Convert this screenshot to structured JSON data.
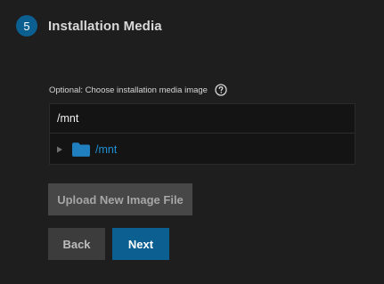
{
  "step": {
    "number": "5",
    "title": "Installation Media"
  },
  "field": {
    "label": "Optional: Choose installation media image",
    "help_icon": "help-circle-icon"
  },
  "explorer": {
    "path_value": "/mnt",
    "tree": [
      {
        "label": "/mnt",
        "expanded": false,
        "icon": "folder-icon"
      }
    ]
  },
  "buttons": {
    "upload": "Upload New Image File",
    "back": "Back",
    "next": "Next"
  },
  "colors": {
    "background": "#1e1e1e",
    "accent": "#0b5f91",
    "folder": "#1f7fbf",
    "link": "#1f8fd3"
  }
}
